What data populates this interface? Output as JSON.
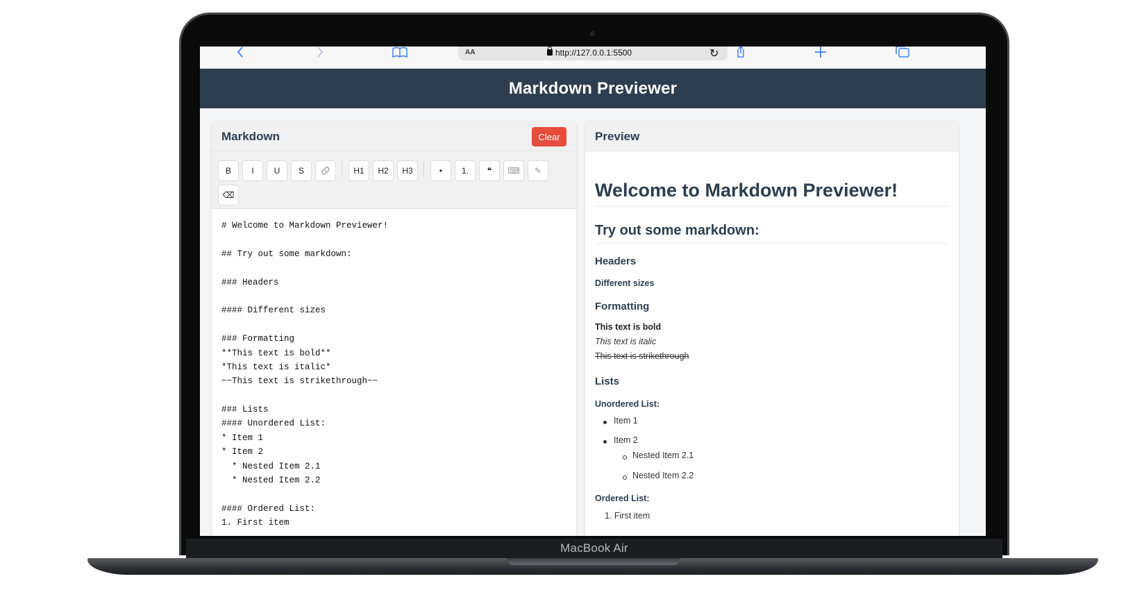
{
  "device": {
    "label": "MacBook Air"
  },
  "browser": {
    "aa_label": "AA",
    "url": "http://127.0.0.1:5500",
    "back_icon": "chevron-left-icon",
    "forward_icon": "chevron-right-icon",
    "bookmarks_icon": "book-icon",
    "reload_icon": "reload-icon",
    "share_icon": "share-icon",
    "new_tab_icon": "plus-icon",
    "tabs_icon": "tabs-icon",
    "accent_color": "#3b82f6"
  },
  "header": {
    "title": "Markdown Previewer",
    "background": "#2d3e50"
  },
  "editor": {
    "title": "Markdown",
    "clear_label": "Clear",
    "clear_color": "#e74c3c",
    "toolbar": {
      "bold": "B",
      "italic": "I",
      "underline": "U",
      "strike": "S",
      "link": "🔗",
      "h1": "H1",
      "h2": "H2",
      "h3": "H3",
      "bullet": "•",
      "numbered": "1.",
      "quote": "❝",
      "code": "⌨",
      "hr": "✎",
      "erase": "⌫"
    },
    "lines": [
      "# Welcome to Markdown Previewer!",
      "",
      "## Try out some markdown:",
      "",
      "### Headers",
      "",
      "#### Different sizes",
      "",
      "### Formatting",
      "**This text is bold**",
      "*This text is italic*",
      "~~This text is strikethrough~~",
      "",
      "### Lists",
      "#### Unordered List:",
      "* Item 1",
      "* Item 2",
      "  * Nested Item 2.1",
      "  * Nested Item 2.2",
      "",
      "#### Ordered List:",
      "1. First item"
    ]
  },
  "preview": {
    "title": "Preview",
    "h1": "Welcome to Markdown Previewer!",
    "h2": "Try out some markdown:",
    "h3_headers": "Headers",
    "h4_sizes": "Different sizes",
    "h3_formatting": "Formatting",
    "bold_text": "This text is bold",
    "italic_text": "This text is italic",
    "strike_text": "This text is strikethrough",
    "h3_lists": "Lists",
    "h4_unordered": "Unordered List:",
    "item1": "Item 1",
    "item2": "Item 2",
    "nested1": "Nested Item 2.1",
    "nested2": "Nested Item 2.2",
    "h4_ordered": "Ordered List:",
    "ordered1": "1. First item"
  }
}
